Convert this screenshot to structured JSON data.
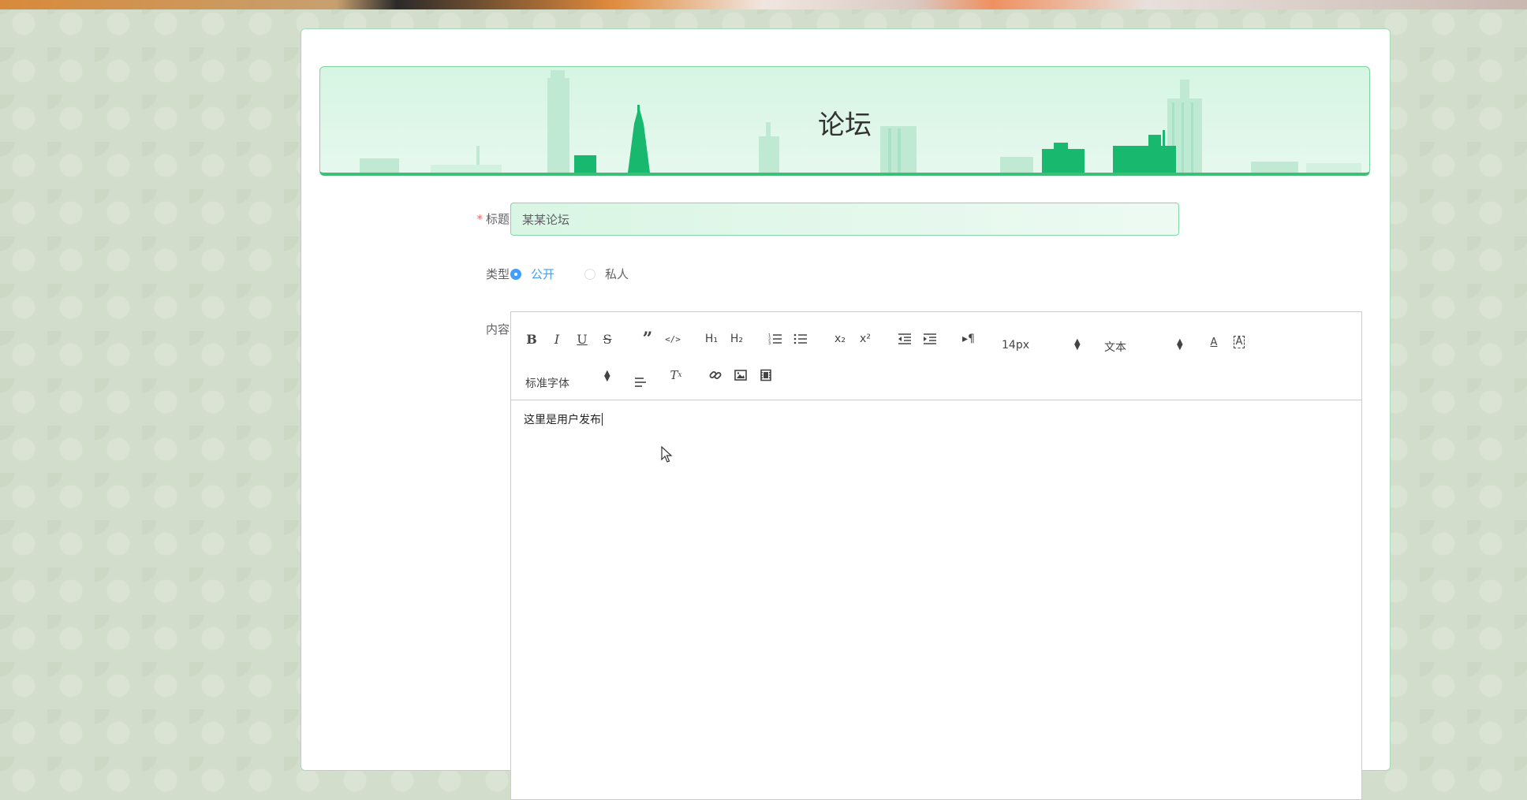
{
  "banner": {
    "title": "论坛"
  },
  "form": {
    "title_label": "标题",
    "title_required_mark": "*",
    "title_value": "某某论坛",
    "type_label": "类型",
    "type_options": [
      {
        "label": "公开",
        "checked": true
      },
      {
        "label": "私人",
        "checked": false
      }
    ],
    "content_label": "内容"
  },
  "editor": {
    "toolbar": {
      "buttons_row1": [
        "bold-icon",
        "italic-icon",
        "underline-icon",
        "strike-icon",
        "blockquote-icon",
        "code-block-icon",
        "header1-icon",
        "header2-icon",
        "ordered-list-icon",
        "bullet-list-icon",
        "subscript-icon",
        "superscript-icon",
        "outdent-icon",
        "indent-icon",
        "rtl-direction-icon"
      ],
      "size_picker": "14px",
      "header_picker": "文本",
      "font_picker": "标准字体",
      "buttons_row2": [
        "align-icon",
        "clean-format-icon",
        "link-icon",
        "image-icon",
        "video-icon"
      ],
      "color_icons": [
        "font-color-icon",
        "background-color-icon"
      ]
    },
    "content": "这里是用户发布"
  },
  "colors": {
    "accent_green": "#3fbf75",
    "primary_blue": "#409eff",
    "required_red": "#f56c6c"
  }
}
